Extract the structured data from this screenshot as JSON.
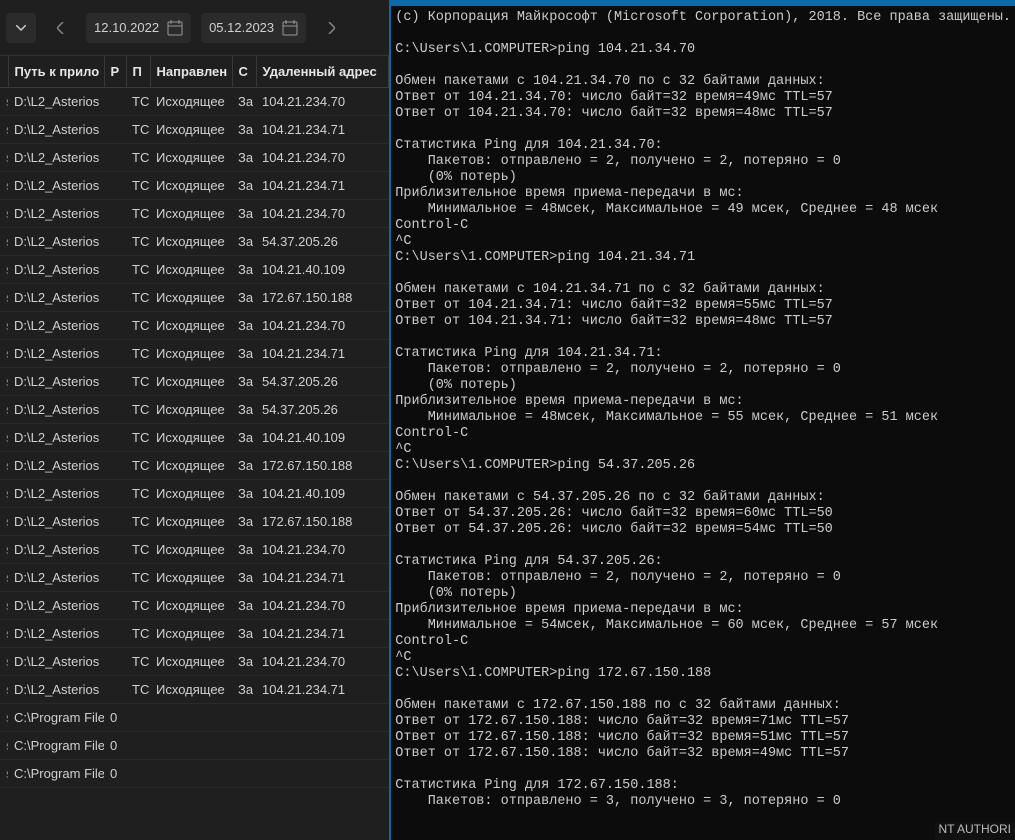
{
  "toolbar": {
    "date_from": "12.10.2022",
    "date_to": "05.12.2023"
  },
  "table": {
    "headers": {
      "path": "Путь к прило",
      "p": "Р",
      "pp": "П",
      "direction": "Направлен",
      "c": "С",
      "remote": "Удаленный адрес"
    },
    "rows": [
      {
        "path": "D:\\L2_Asterios",
        "p": "",
        "pp": "TC",
        "dir": "Исходящее",
        "c": "За",
        "remote": "104.21.234.70"
      },
      {
        "path": "D:\\L2_Asterios",
        "p": "",
        "pp": "TC",
        "dir": "Исходящее",
        "c": "За",
        "remote": "104.21.234.71"
      },
      {
        "path": "D:\\L2_Asterios",
        "p": "",
        "pp": "TC",
        "dir": "Исходящее",
        "c": "За",
        "remote": "104.21.234.70"
      },
      {
        "path": "D:\\L2_Asterios",
        "p": "",
        "pp": "TC",
        "dir": "Исходящее",
        "c": "За",
        "remote": "104.21.234.71"
      },
      {
        "path": "D:\\L2_Asterios",
        "p": "",
        "pp": "TC",
        "dir": "Исходящее",
        "c": "За",
        "remote": "104.21.234.70"
      },
      {
        "path": "D:\\L2_Asterios",
        "p": "",
        "pp": "TC",
        "dir": "Исходящее",
        "c": "За",
        "remote": "54.37.205.26"
      },
      {
        "path": "D:\\L2_Asterios",
        "p": "",
        "pp": "TC",
        "dir": "Исходящее",
        "c": "За",
        "remote": "104.21.40.109"
      },
      {
        "path": "D:\\L2_Asterios",
        "p": "",
        "pp": "TC",
        "dir": "Исходящее",
        "c": "За",
        "remote": "172.67.150.188"
      },
      {
        "path": "D:\\L2_Asterios",
        "p": "",
        "pp": "TC",
        "dir": "Исходящее",
        "c": "За",
        "remote": "104.21.234.70"
      },
      {
        "path": "D:\\L2_Asterios",
        "p": "",
        "pp": "TC",
        "dir": "Исходящее",
        "c": "За",
        "remote": "104.21.234.71"
      },
      {
        "path": "D:\\L2_Asterios",
        "p": "",
        "pp": "TC",
        "dir": "Исходящее",
        "c": "За",
        "remote": "54.37.205.26"
      },
      {
        "path": "D:\\L2_Asterios",
        "p": "",
        "pp": "TC",
        "dir": "Исходящее",
        "c": "За",
        "remote": "54.37.205.26"
      },
      {
        "path": "D:\\L2_Asterios",
        "p": "",
        "pp": "TC",
        "dir": "Исходящее",
        "c": "За",
        "remote": "104.21.40.109"
      },
      {
        "path": "D:\\L2_Asterios",
        "p": "",
        "pp": "TC",
        "dir": "Исходящее",
        "c": "За",
        "remote": "172.67.150.188"
      },
      {
        "path": "D:\\L2_Asterios",
        "p": "",
        "pp": "TC",
        "dir": "Исходящее",
        "c": "За",
        "remote": "104.21.40.109"
      },
      {
        "path": "D:\\L2_Asterios",
        "p": "",
        "pp": "TC",
        "dir": "Исходящее",
        "c": "За",
        "remote": "172.67.150.188"
      },
      {
        "path": "D:\\L2_Asterios",
        "p": "",
        "pp": "TC",
        "dir": "Исходящее",
        "c": "За",
        "remote": "104.21.234.70"
      },
      {
        "path": "D:\\L2_Asterios",
        "p": "",
        "pp": "TC",
        "dir": "Исходящее",
        "c": "За",
        "remote": "104.21.234.71"
      },
      {
        "path": "D:\\L2_Asterios",
        "p": "",
        "pp": "TC",
        "dir": "Исходящее",
        "c": "За",
        "remote": "104.21.234.70"
      },
      {
        "path": "D:\\L2_Asterios",
        "p": "",
        "pp": "TC",
        "dir": "Исходящее",
        "c": "За",
        "remote": "104.21.234.71"
      },
      {
        "path": "D:\\L2_Asterios",
        "p": "",
        "pp": "TC",
        "dir": "Исходящее",
        "c": "За",
        "remote": "104.21.234.70"
      },
      {
        "path": "D:\\L2_Asterios",
        "p": "",
        "pp": "TC",
        "dir": "Исходящее",
        "c": "За",
        "remote": "104.21.234.71"
      },
      {
        "path": "C:\\Program File",
        "p": "0",
        "pp": "",
        "dir": "",
        "c": "",
        "remote": ""
      },
      {
        "path": "C:\\Program File",
        "p": "0",
        "pp": "",
        "dir": "",
        "c": "",
        "remote": ""
      },
      {
        "path": "C:\\Program File",
        "p": "0",
        "pp": "",
        "dir": "",
        "c": "",
        "remote": ""
      }
    ]
  },
  "terminal": {
    "lines": [
      "(c) Корпорация Майкрософт (Microsoft Corporation), 2018. Все права защищены.",
      "",
      "C:\\Users\\1.COMPUTER>ping 104.21.34.70",
      "",
      "Обмен пакетами с 104.21.34.70 по с 32 байтами данных:",
      "Ответ от 104.21.34.70: число байт=32 время=49мс TTL=57",
      "Ответ от 104.21.34.70: число байт=32 время=48мс TTL=57",
      "",
      "Статистика Ping для 104.21.34.70:",
      "    Пакетов: отправлено = 2, получено = 2, потеряно = 0",
      "    (0% потерь)",
      "Приблизительное время приема-передачи в мс:",
      "    Минимальное = 48мсек, Максимальное = 49 мсек, Среднее = 48 мсек",
      "Control-C",
      "^C",
      "C:\\Users\\1.COMPUTER>ping 104.21.34.71",
      "",
      "Обмен пакетами с 104.21.34.71 по с 32 байтами данных:",
      "Ответ от 104.21.34.71: число байт=32 время=55мс TTL=57",
      "Ответ от 104.21.34.71: число байт=32 время=48мс TTL=57",
      "",
      "Статистика Ping для 104.21.34.71:",
      "    Пакетов: отправлено = 2, получено = 2, потеряно = 0",
      "    (0% потерь)",
      "Приблизительное время приема-передачи в мс:",
      "    Минимальное = 48мсек, Максимальное = 55 мсек, Среднее = 51 мсек",
      "Control-C",
      "^C",
      "C:\\Users\\1.COMPUTER>ping 54.37.205.26",
      "",
      "Обмен пакетами с 54.37.205.26 по с 32 байтами данных:",
      "Ответ от 54.37.205.26: число байт=32 время=60мс TTL=50",
      "Ответ от 54.37.205.26: число байт=32 время=54мс TTL=50",
      "",
      "Статистика Ping для 54.37.205.26:",
      "    Пакетов: отправлено = 2, получено = 2, потеряно = 0",
      "    (0% потерь)",
      "Приблизительное время приема-передачи в мс:",
      "    Минимальное = 54мсек, Максимальное = 60 мсек, Среднее = 57 мсек",
      "Control-C",
      "^C",
      "C:\\Users\\1.COMPUTER>ping 172.67.150.188",
      "",
      "Обмен пакетами с 172.67.150.188 по с 32 байтами данных:",
      "Ответ от 172.67.150.188: число байт=32 время=71мс TTL=57",
      "Ответ от 172.67.150.188: число байт=32 время=51мс TTL=57",
      "Ответ от 172.67.150.188: число байт=32 время=49мс TTL=57",
      "",
      "Статистика Ping для 172.67.150.188:",
      "    Пакетов: отправлено = 3, получено = 3, потеряно = 0"
    ],
    "status": "NT AUTHORI"
  }
}
